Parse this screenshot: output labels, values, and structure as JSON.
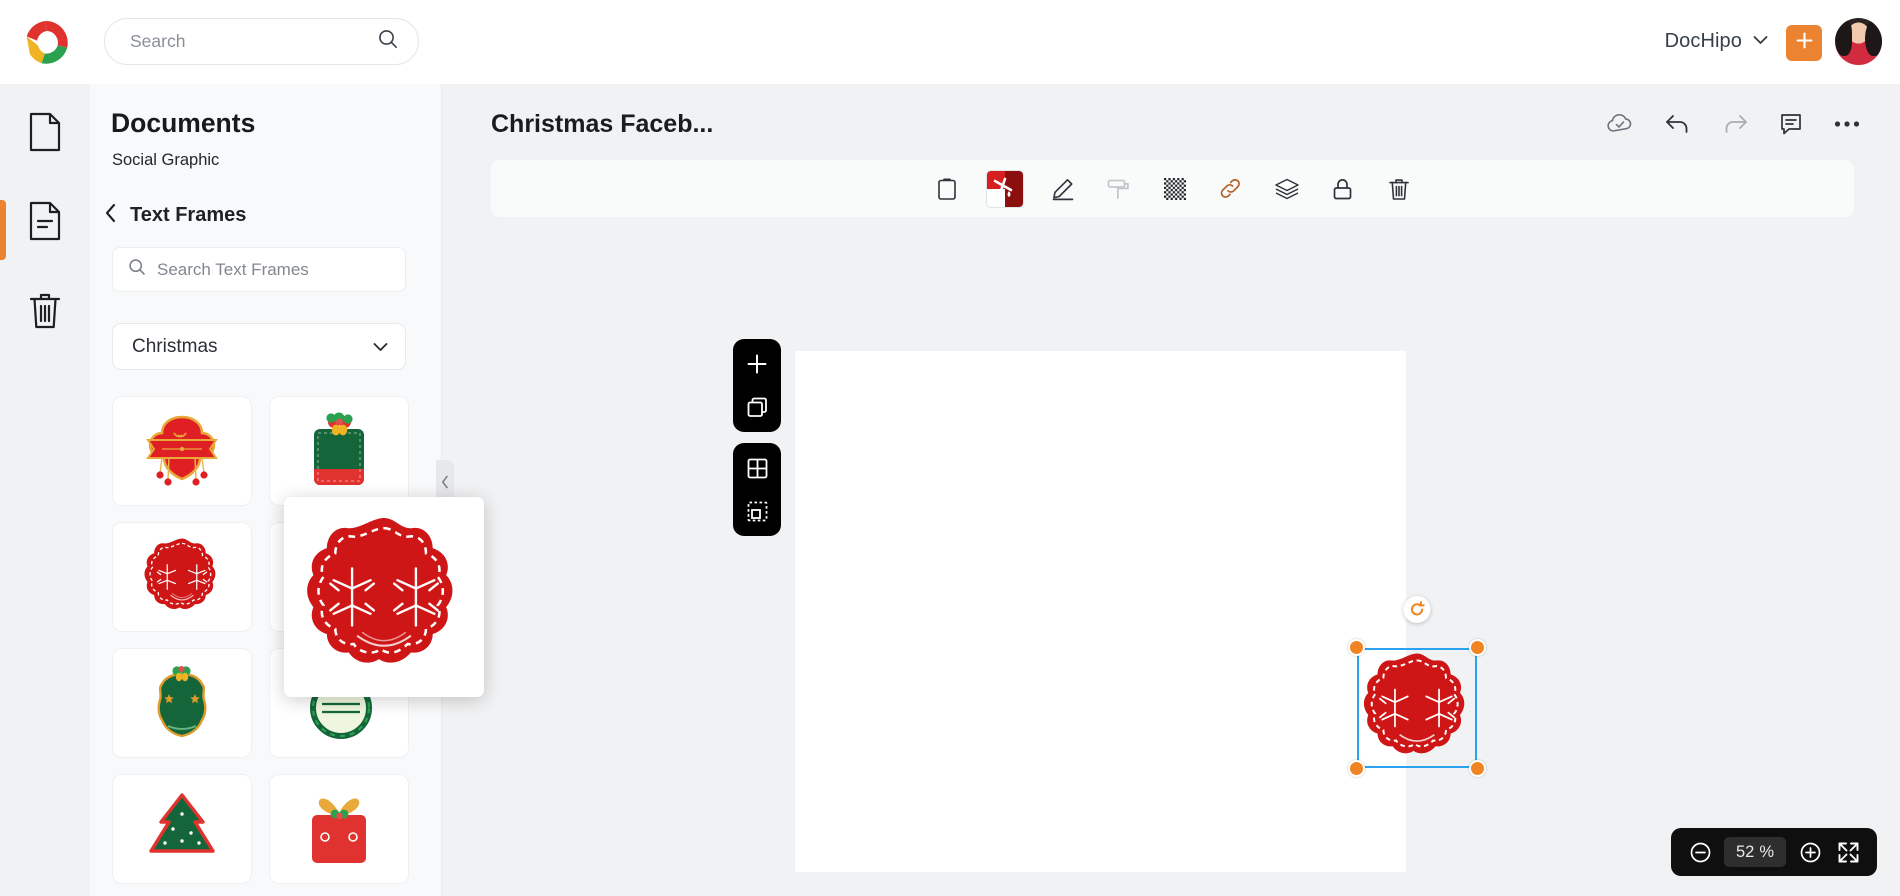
{
  "topbar": {
    "logo_icon": "dochipo-logo-icon",
    "search_placeholder": "Search",
    "search_value": "",
    "search_icon": "search-icon",
    "brand_name": "DocHipo",
    "brand_chevron_icon": "chevron-down-icon",
    "create_icon": "plus-icon",
    "avatar_name": "user-avatar",
    "accent_orange": "#ec8330"
  },
  "rail": {
    "items": [
      {
        "name": "blank-page",
        "icon": "page-icon",
        "active": false
      },
      {
        "name": "documents",
        "icon": "document-lines-icon",
        "active": true
      },
      {
        "name": "trash",
        "icon": "trash-icon",
        "active": false
      }
    ]
  },
  "panel": {
    "title": "Documents",
    "subtitle": "Social Graphic",
    "back_icon": "chevron-left-icon",
    "back_label": "Text Frames",
    "search_placeholder": "Search Text Frames",
    "search_value": "",
    "search_icon": "search-icon",
    "category": "Christmas",
    "category_chevron_icon": "chevron-down-icon",
    "collapse_icon": "chevron-left-icon",
    "thumbs": [
      {
        "name": "red-gold-banner-frame"
      },
      {
        "name": "green-gift-tag-frame"
      },
      {
        "name": "red-scalloped-snowflake-frame"
      },
      {
        "name": "red-scalloped-frame-2"
      },
      {
        "name": "green-gold-ornate-frame"
      },
      {
        "name": "santa-hat-circle-frame"
      },
      {
        "name": "christmas-tree-frame"
      },
      {
        "name": "red-gift-box-frame"
      }
    ],
    "preview_name": "red-scalloped-snowflake-frame-preview"
  },
  "main": {
    "doc_title": "Christmas Faceb...",
    "top_actions": [
      {
        "name": "cloud-saved-icon",
        "state": "saved"
      },
      {
        "name": "undo-icon",
        "state": "enabled"
      },
      {
        "name": "redo-icon",
        "state": "disabled"
      },
      {
        "name": "comment-icon",
        "state": "enabled"
      },
      {
        "name": "more-options-icon",
        "state": "enabled"
      }
    ],
    "object_toolbar": [
      {
        "name": "clipboard-icon",
        "label": "Copy",
        "active": false
      },
      {
        "name": "color-swatch-icon",
        "label": "Color",
        "active": true,
        "color_a": "#d81f1f",
        "color_b": "#8c0f0f"
      },
      {
        "name": "edit-pencil-icon",
        "label": "Edit",
        "active": false
      },
      {
        "name": "paint-roller-icon",
        "label": "Style",
        "active": false,
        "disabled": true
      },
      {
        "name": "transparency-icon",
        "label": "Transparency",
        "active": false
      },
      {
        "name": "link-icon",
        "label": "Link",
        "active": false
      },
      {
        "name": "layers-icon",
        "label": "Layers",
        "active": false
      },
      {
        "name": "lock-icon",
        "label": "Lock",
        "active": false
      },
      {
        "name": "delete-icon",
        "label": "Delete",
        "active": false
      }
    ],
    "page_tools": [
      {
        "name": "add-page-icon"
      },
      {
        "name": "duplicate-page-icon"
      },
      {
        "name": "grid-icon"
      },
      {
        "name": "select-area-icon"
      }
    ],
    "selection": {
      "object_name": "red-scalloped-snowflake-frame",
      "rotate_icon": "rotate-icon",
      "handle_color": "#ef8421",
      "frame_color": "#29a3f0"
    }
  },
  "zoom": {
    "zoom_out_icon": "minus-circle-icon",
    "value": "52",
    "unit": "%",
    "zoom_in_icon": "plus-circle-icon",
    "fullscreen_icon": "expand-icon"
  }
}
